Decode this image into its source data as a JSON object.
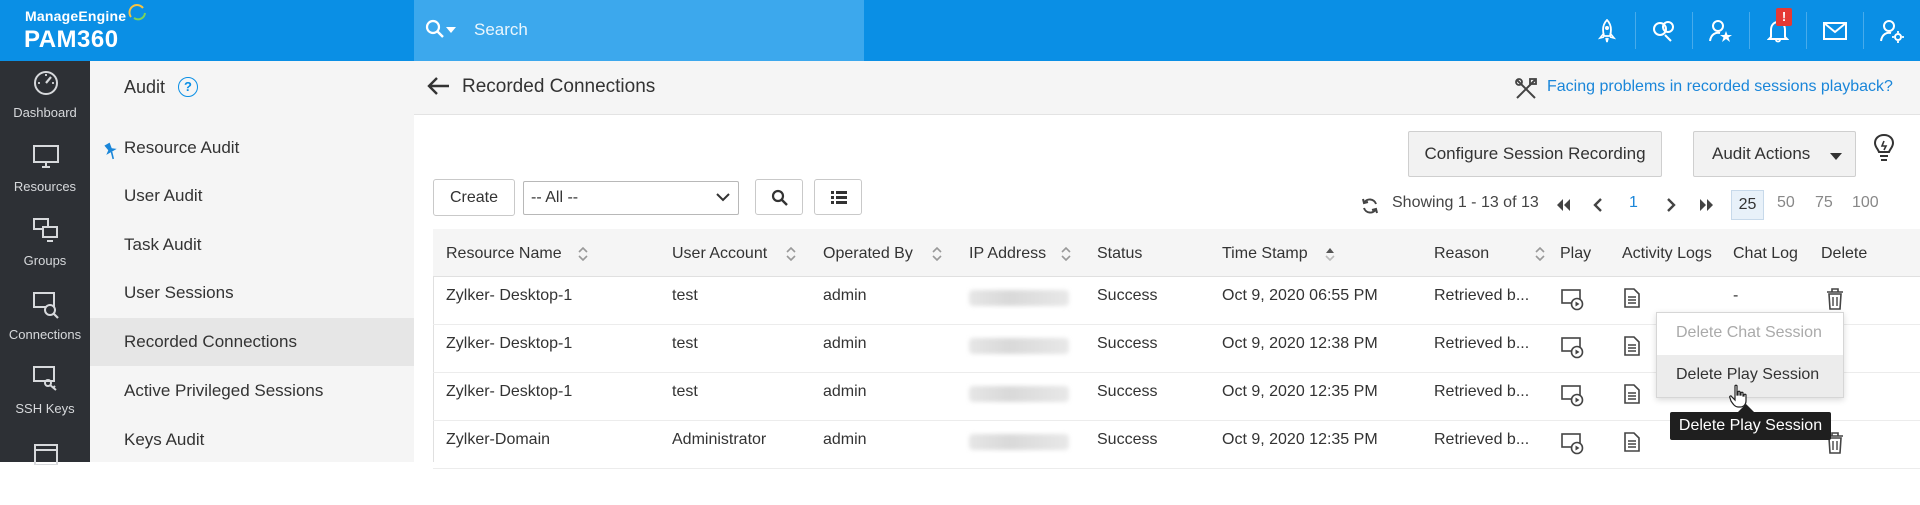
{
  "brand": {
    "company": "ManageEngine",
    "product": "PAM360"
  },
  "search": {
    "placeholder": "Search"
  },
  "topbar": {
    "notification_badge": "!"
  },
  "leftnav": [
    {
      "label": "Dashboard",
      "icon": "dashboard-icon"
    },
    {
      "label": "Resources",
      "icon": "monitor-icon"
    },
    {
      "label": "Groups",
      "icon": "groups-icon"
    },
    {
      "label": "Connections",
      "icon": "connections-icon"
    },
    {
      "label": "SSH Keys",
      "icon": "ssh-keys-icon"
    }
  ],
  "subnav": {
    "title": "Audit",
    "help": "?",
    "items": [
      {
        "label": "Resource Audit"
      },
      {
        "label": "User Audit"
      },
      {
        "label": "Task Audit"
      },
      {
        "label": "User Sessions"
      },
      {
        "label": "Recorded Connections"
      },
      {
        "label": "Active Privileged Sessions"
      },
      {
        "label": "Keys Audit"
      }
    ]
  },
  "main": {
    "title": "Recorded Connections",
    "help_link": "Facing problems in recorded sessions playback?",
    "configure_btn": "Configure Session Recording",
    "audit_actions_btn": "Audit Actions",
    "create_btn": "Create",
    "filter_value": "-- All --"
  },
  "pager": {
    "showing": "Showing 1 - 13 of 13",
    "page": "1",
    "sizes": [
      "25",
      "50",
      "75",
      "100"
    ]
  },
  "table": {
    "headers": [
      "Resource Name",
      "User Account",
      "Operated By",
      "IP Address",
      "Status",
      "Time Stamp",
      "Reason",
      "Play",
      "Activity Logs",
      "Chat Log",
      "Delete"
    ],
    "rows": [
      {
        "resource": "Zylker- Desktop-1",
        "account": "test",
        "operated_by": "admin",
        "status": "Success",
        "timestamp": "Oct 9, 2020 06:55 PM",
        "reason": "Retrieved b...",
        "chat": "-"
      },
      {
        "resource": "Zylker- Desktop-1",
        "account": "test",
        "operated_by": "admin",
        "status": "Success",
        "timestamp": "Oct 9, 2020 12:38 PM",
        "reason": "Retrieved b...",
        "chat": ""
      },
      {
        "resource": "Zylker- Desktop-1",
        "account": "test",
        "operated_by": "admin",
        "status": "Success",
        "timestamp": "Oct 9, 2020 12:35 PM",
        "reason": "Retrieved b...",
        "chat": ""
      },
      {
        "resource": "Zylker-Domain",
        "account": "Administrator",
        "operated_by": "admin",
        "status": "Success",
        "timestamp": "Oct 9, 2020 12:35 PM",
        "reason": "Retrieved b...",
        "chat": ""
      }
    ]
  },
  "context_menu": {
    "item1": "Delete Chat Session",
    "item2": "Delete Play Session"
  },
  "tooltip": "Delete Play Session",
  "colors": {
    "topbar": "#0a8fe5",
    "search": "#3ca8ed",
    "sidebar": "#2d3035",
    "link": "#1a86d9"
  }
}
